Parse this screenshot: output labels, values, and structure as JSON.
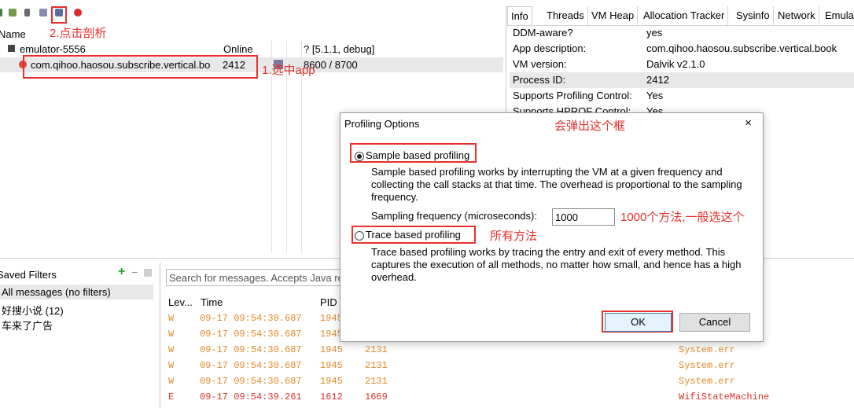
{
  "devices": {
    "header": {
      "name": "Name"
    },
    "emulator": {
      "name": "emulator-5556",
      "status": "Online",
      "version": "? [5.1.1, debug]"
    },
    "process": {
      "name": "com.qihoo.haosou.subscribe.vertical.bo",
      "pid": "2412",
      "ports": "8600 / 8700"
    }
  },
  "annotations": {
    "step2": "2.点击剖析",
    "step1": "1.选中app",
    "popup": "会弹出这个框",
    "freq_note": "1000个方法,一般选这个",
    "trace_note": "所有方法"
  },
  "info_panel": {
    "tabs": [
      "Info",
      "Threads",
      "VM Heap",
      "Allocation Tracker",
      "Sysinfo",
      "Network",
      "Emula"
    ],
    "rows": [
      {
        "key": "DDM-aware?",
        "value": "yes"
      },
      {
        "key": "App description:",
        "value": "com.qihoo.haosou.subscribe.vertical.book"
      },
      {
        "key": "VM version:",
        "value": "Dalvik v2.1.0"
      },
      {
        "key": "Process ID:",
        "value": "2412"
      },
      {
        "key": "Supports Profiling Control:",
        "value": "Yes"
      },
      {
        "key": "Supports HPROF Control:",
        "value": "Yes"
      }
    ]
  },
  "dialog": {
    "title": "Profiling Options",
    "close": "×",
    "sample_label": "Sample based profiling",
    "sample_desc": "Sample based profiling works by interrupting the VM at a given frequency and collecting the call stacks at that time. The overhead is proportional to the sampling frequency.",
    "freq_label": "Sampling frequency (microseconds):",
    "freq_value": "1000",
    "trace_label": "Trace based profiling",
    "trace_desc": "Trace based profiling works by tracing the entry and exit of every method. This captures the execution of all methods, no matter how small, and hence has a high overhead.",
    "ok": "OK",
    "cancel": "Cancel"
  },
  "filters": {
    "title": "Saved Filters",
    "add": "+",
    "remove": "−",
    "items": [
      "All messages (no filters)",
      "好搜小说 (12)",
      "车来了广告"
    ]
  },
  "logcat": {
    "search_placeholder": "Search for messages. Accepts Java re",
    "columns": {
      "level": "Lev...",
      "time": "Time",
      "pid": "PID"
    },
    "rows": [
      {
        "level": "W",
        "time": "09-17 09:54:30.687",
        "pid": "1945",
        "tid": "",
        "tag": ""
      },
      {
        "level": "W",
        "time": "09-17 09:54:30.687",
        "pid": "1945",
        "tid": "",
        "tag": ""
      },
      {
        "level": "W",
        "time": "09-17 09:54:30.687",
        "pid": "1945",
        "tid": "2131",
        "tag": "System.err"
      },
      {
        "level": "W",
        "time": "09-17 09:54:30.687",
        "pid": "1945",
        "tid": "2131",
        "tag": "System.err"
      },
      {
        "level": "W",
        "time": "09-17 09:54:30.687",
        "pid": "1945",
        "tid": "2131",
        "tag": "System.err"
      },
      {
        "level": "E",
        "time": "09-17 09:54:39.261",
        "pid": "1612",
        "tid": "1669",
        "tag": "WifiStateMachine"
      }
    ]
  },
  "colors": {
    "accent_red": "#e8302c",
    "warn": "#e08a2a",
    "error": "#d8332a"
  }
}
